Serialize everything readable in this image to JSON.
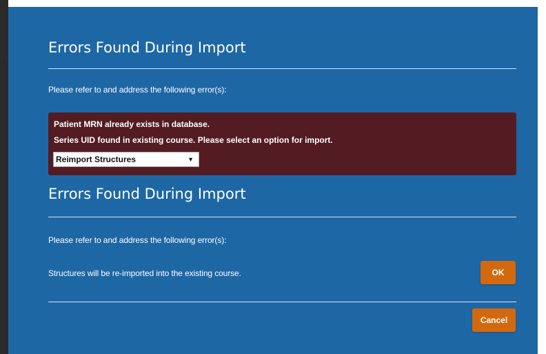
{
  "dialog_top": {
    "title": "Errors Found During Import",
    "instruction": "Please refer to and address the following error(s):",
    "errors": [
      "Patient MRN already exists in database.",
      "Series UID found in existing course. Please select an option for import."
    ],
    "import_option": {
      "selected": "Reimport Structures",
      "caret_icon": "▼"
    }
  },
  "dialog_bottom": {
    "title": "Errors Found During Import",
    "instruction": "Please refer to and address the following error(s):",
    "message": "Structures will be re-imported into the existing course.",
    "ok_label": "OK",
    "cancel_label": "Cancel"
  },
  "colors": {
    "dialog_bg": "#1e67a5",
    "error_bg": "#531c22",
    "button_bg": "#d2690f"
  }
}
